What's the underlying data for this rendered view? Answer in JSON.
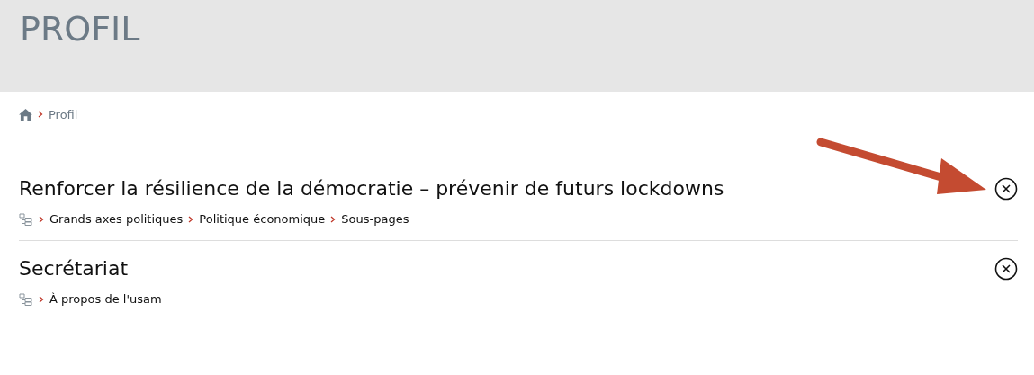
{
  "header": {
    "title": "PROFIL"
  },
  "breadcrumb": [
    "Profil"
  ],
  "items": [
    {
      "title": "Renforcer la résilience de la démocratie – prévenir de futurs lockdowns",
      "path": [
        "Grands axes politiques",
        "Politique économique",
        "Sous-pages"
      ]
    },
    {
      "title": "Secrétariat",
      "path": [
        "À propos de l'usam"
      ]
    }
  ]
}
